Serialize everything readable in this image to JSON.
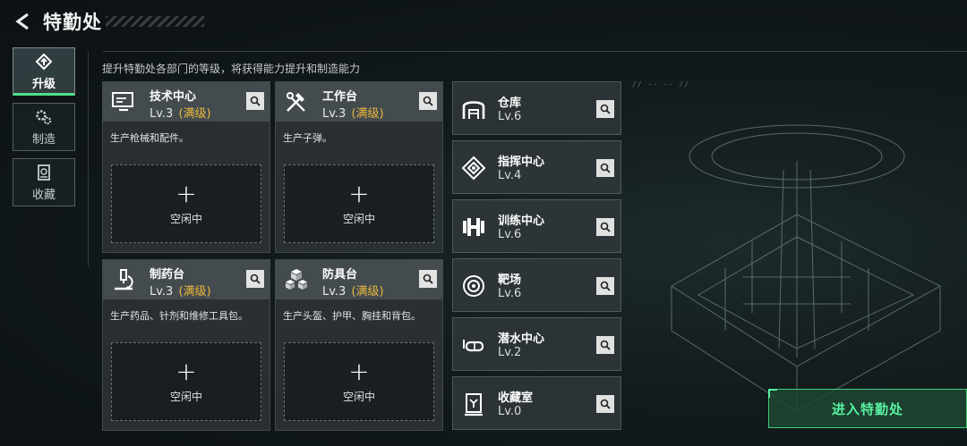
{
  "header": {
    "title": "特勤处"
  },
  "subtitle": "提升特勤处各部门的等级，将获得能力提升和制造能力",
  "side_tabs": [
    {
      "label": "升级",
      "icon": "upgrade-icon",
      "active": true
    },
    {
      "label": "制造",
      "icon": "gears-icon",
      "active": false
    },
    {
      "label": "收藏",
      "icon": "collection-icon",
      "active": false
    }
  ],
  "cards": [
    {
      "name": "技术中心",
      "level": "Lv.3",
      "max_label": "(满级)",
      "desc": "生产枪械和配件。",
      "slot_label": "空闲中",
      "icon": "computer-icon"
    },
    {
      "name": "工作台",
      "level": "Lv.3",
      "max_label": "(满级)",
      "desc": "生产子弹。",
      "slot_label": "空闲中",
      "icon": "tools-icon"
    },
    {
      "name": "制药台",
      "level": "Lv.3",
      "max_label": "(满级)",
      "desc": "生产药品、针剂和维修工具包。",
      "slot_label": "空闲中",
      "icon": "microscope-icon"
    },
    {
      "name": "防具台",
      "level": "Lv.3",
      "max_label": "(满级)",
      "desc": "生产头盔、护甲、胸挂和背包。",
      "slot_label": "空闲中",
      "icon": "armor-cubes-icon"
    }
  ],
  "facilities": [
    {
      "name": "仓库",
      "level": "Lv.6",
      "icon": "warehouse-icon"
    },
    {
      "name": "指挥中心",
      "level": "Lv.4",
      "icon": "command-icon"
    },
    {
      "name": "训练中心",
      "level": "Lv.6",
      "icon": "dumbbell-icon"
    },
    {
      "name": "靶场",
      "level": "Lv.6",
      "icon": "target-icon"
    },
    {
      "name": "潜水中心",
      "level": "Lv.2",
      "icon": "diving-mask-icon"
    },
    {
      "name": "收藏室",
      "level": "Lv.0",
      "icon": "display-case-icon"
    }
  ],
  "enter_button": "进入特勤处",
  "colors": {
    "accent": "#4de08a",
    "max_level": "#e9b93c",
    "enter_text": "#58f0a0"
  }
}
